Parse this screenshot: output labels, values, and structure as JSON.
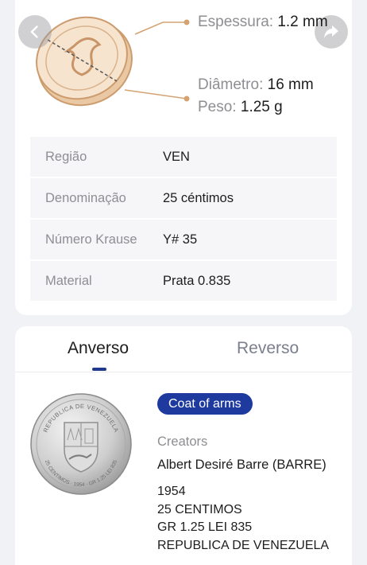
{
  "specs": {
    "thickness_label": "Espessura:",
    "thickness_value": "1.2 mm",
    "diameter_label": "Diâmetro:",
    "diameter_value": "16 mm",
    "weight_label": "Peso:",
    "weight_value": "1.25 g"
  },
  "details": [
    {
      "label": "Região",
      "value": "VEN"
    },
    {
      "label": "Denominação",
      "value": "25 céntimos"
    },
    {
      "label": "Número Krause",
      "value": "Y# 35"
    },
    {
      "label": "Material",
      "value": "Prata 0.835"
    }
  ],
  "tabs": {
    "obverse": "Anverso",
    "reverse": "Reverso"
  },
  "obverse": {
    "badge": "Coat of arms",
    "creators_label": "Creators",
    "creator": "Albert Desiré Barre (BARRE)",
    "inscription": [
      "1954",
      "25 CENTIMOS",
      "GR 1.25 LEI 835",
      "REPUBLICA DE VENEZUELA"
    ],
    "coin_legend_top": "REPUBLICA DE VENEZUELA",
    "coin_legend_bottom": "25 CENTIMOS · 1954 · GR 1.25 LEI 835"
  },
  "colors": {
    "accent": "#1e3a9e",
    "diagram_gold": "#d4a373",
    "coin_fill": "#f6e4cf"
  },
  "icons": {
    "back": "chevron-left-icon",
    "share": "share-icon"
  }
}
